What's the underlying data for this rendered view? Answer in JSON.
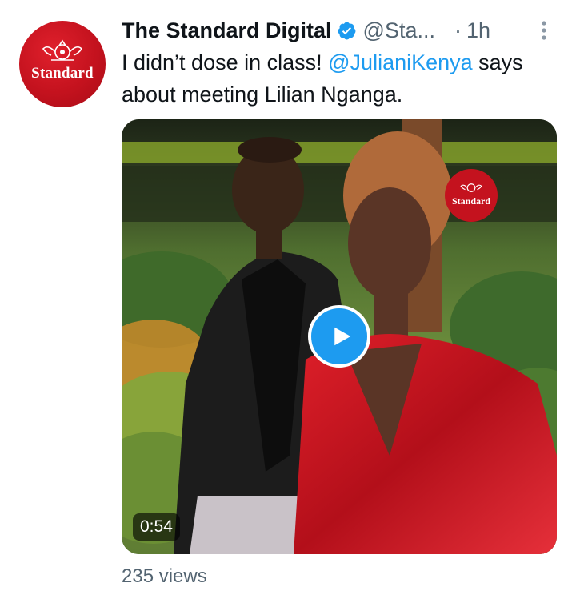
{
  "tweet": {
    "avatar_text": "Standard",
    "display_name": "The Standard Digital",
    "handle": "@Sta...",
    "separator": "·",
    "time": "1h",
    "text_part1": "I didn’t dose in class! ",
    "mention": "@JulianiKenya",
    "text_part2": " says about meeting Lilian Nganga.",
    "views": "235 views"
  },
  "media": {
    "duration": "0:54",
    "watermark_text": "Standard"
  },
  "colors": {
    "accent": "#1d9bf0",
    "secondary_text": "#536471",
    "brand_red": "#c4121e"
  },
  "icons": {
    "verified": "verified-badge-icon",
    "more": "more-vertical-icon",
    "play": "play-icon"
  }
}
